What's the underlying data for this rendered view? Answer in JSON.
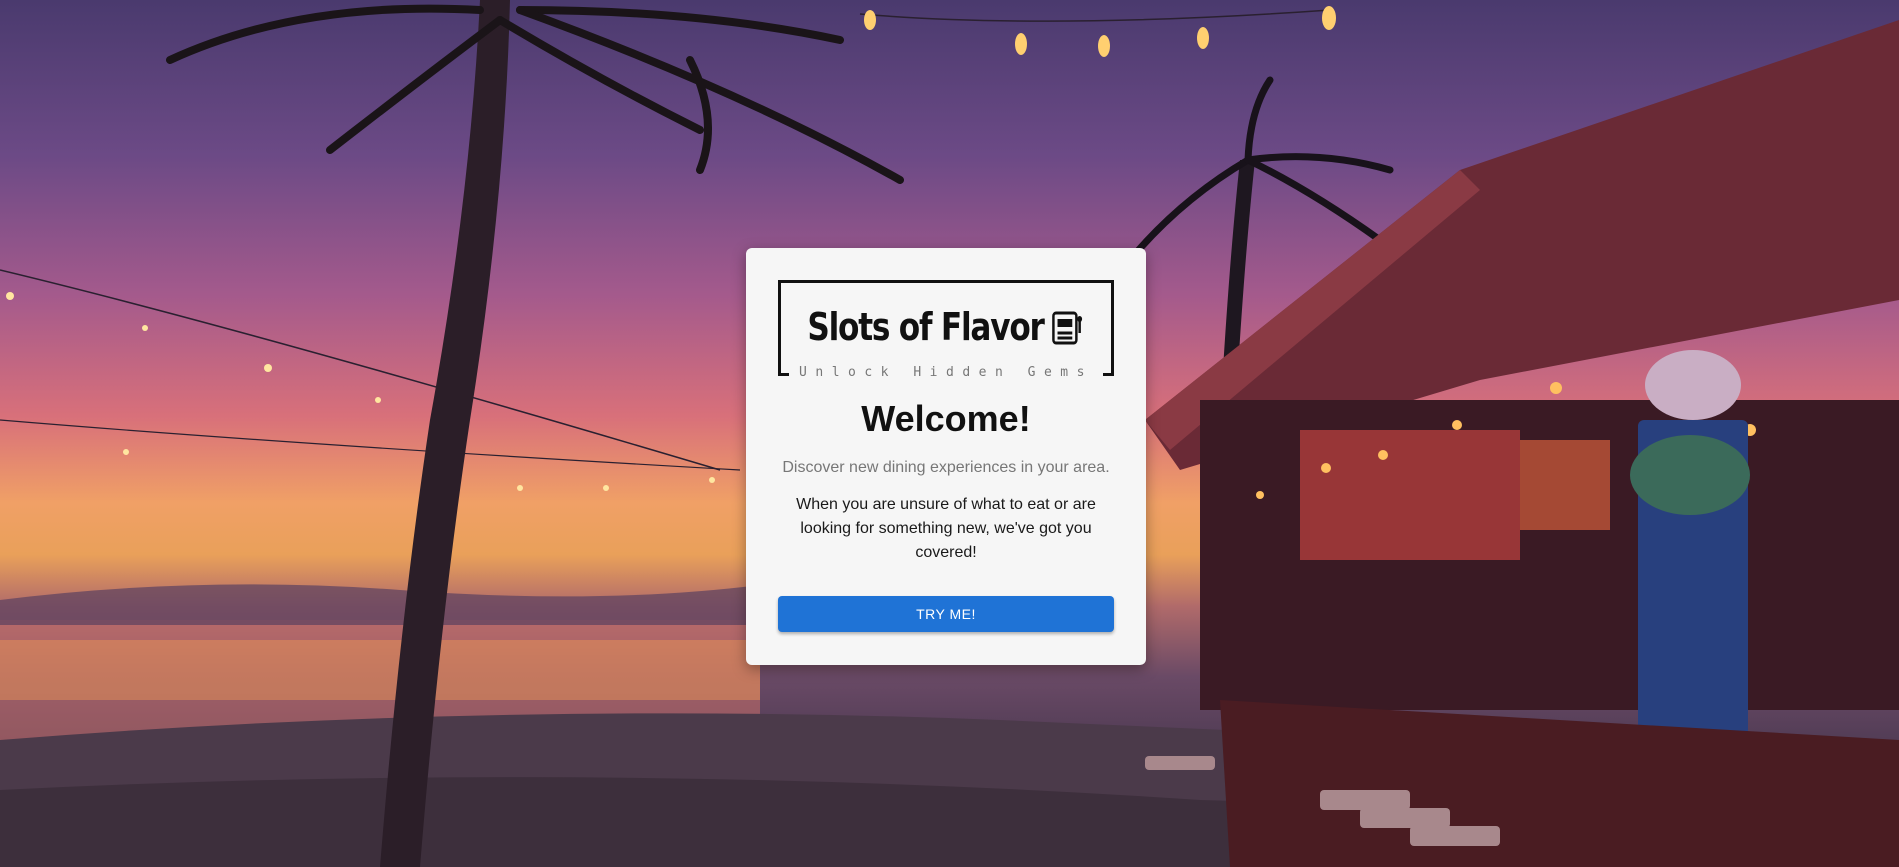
{
  "background": {
    "scene": "tropical-beach-bar-sunset-image",
    "colors": [
      "#4a3a6e",
      "#a45a8c",
      "#f0a066",
      "#3a2c40"
    ]
  },
  "card": {
    "logo": {
      "title": "Slots of Flavor",
      "tagline": "Unlock Hidden Gems",
      "icon": "slot-machine-icon"
    },
    "heading": "Welcome!",
    "subtitle": "Discover new dining experiences in your area.",
    "description": "When you are unsure of what to eat or are looking for something new, we've got you covered!",
    "cta_label": "TRY ME!",
    "accent_color": "#1f73d6"
  }
}
